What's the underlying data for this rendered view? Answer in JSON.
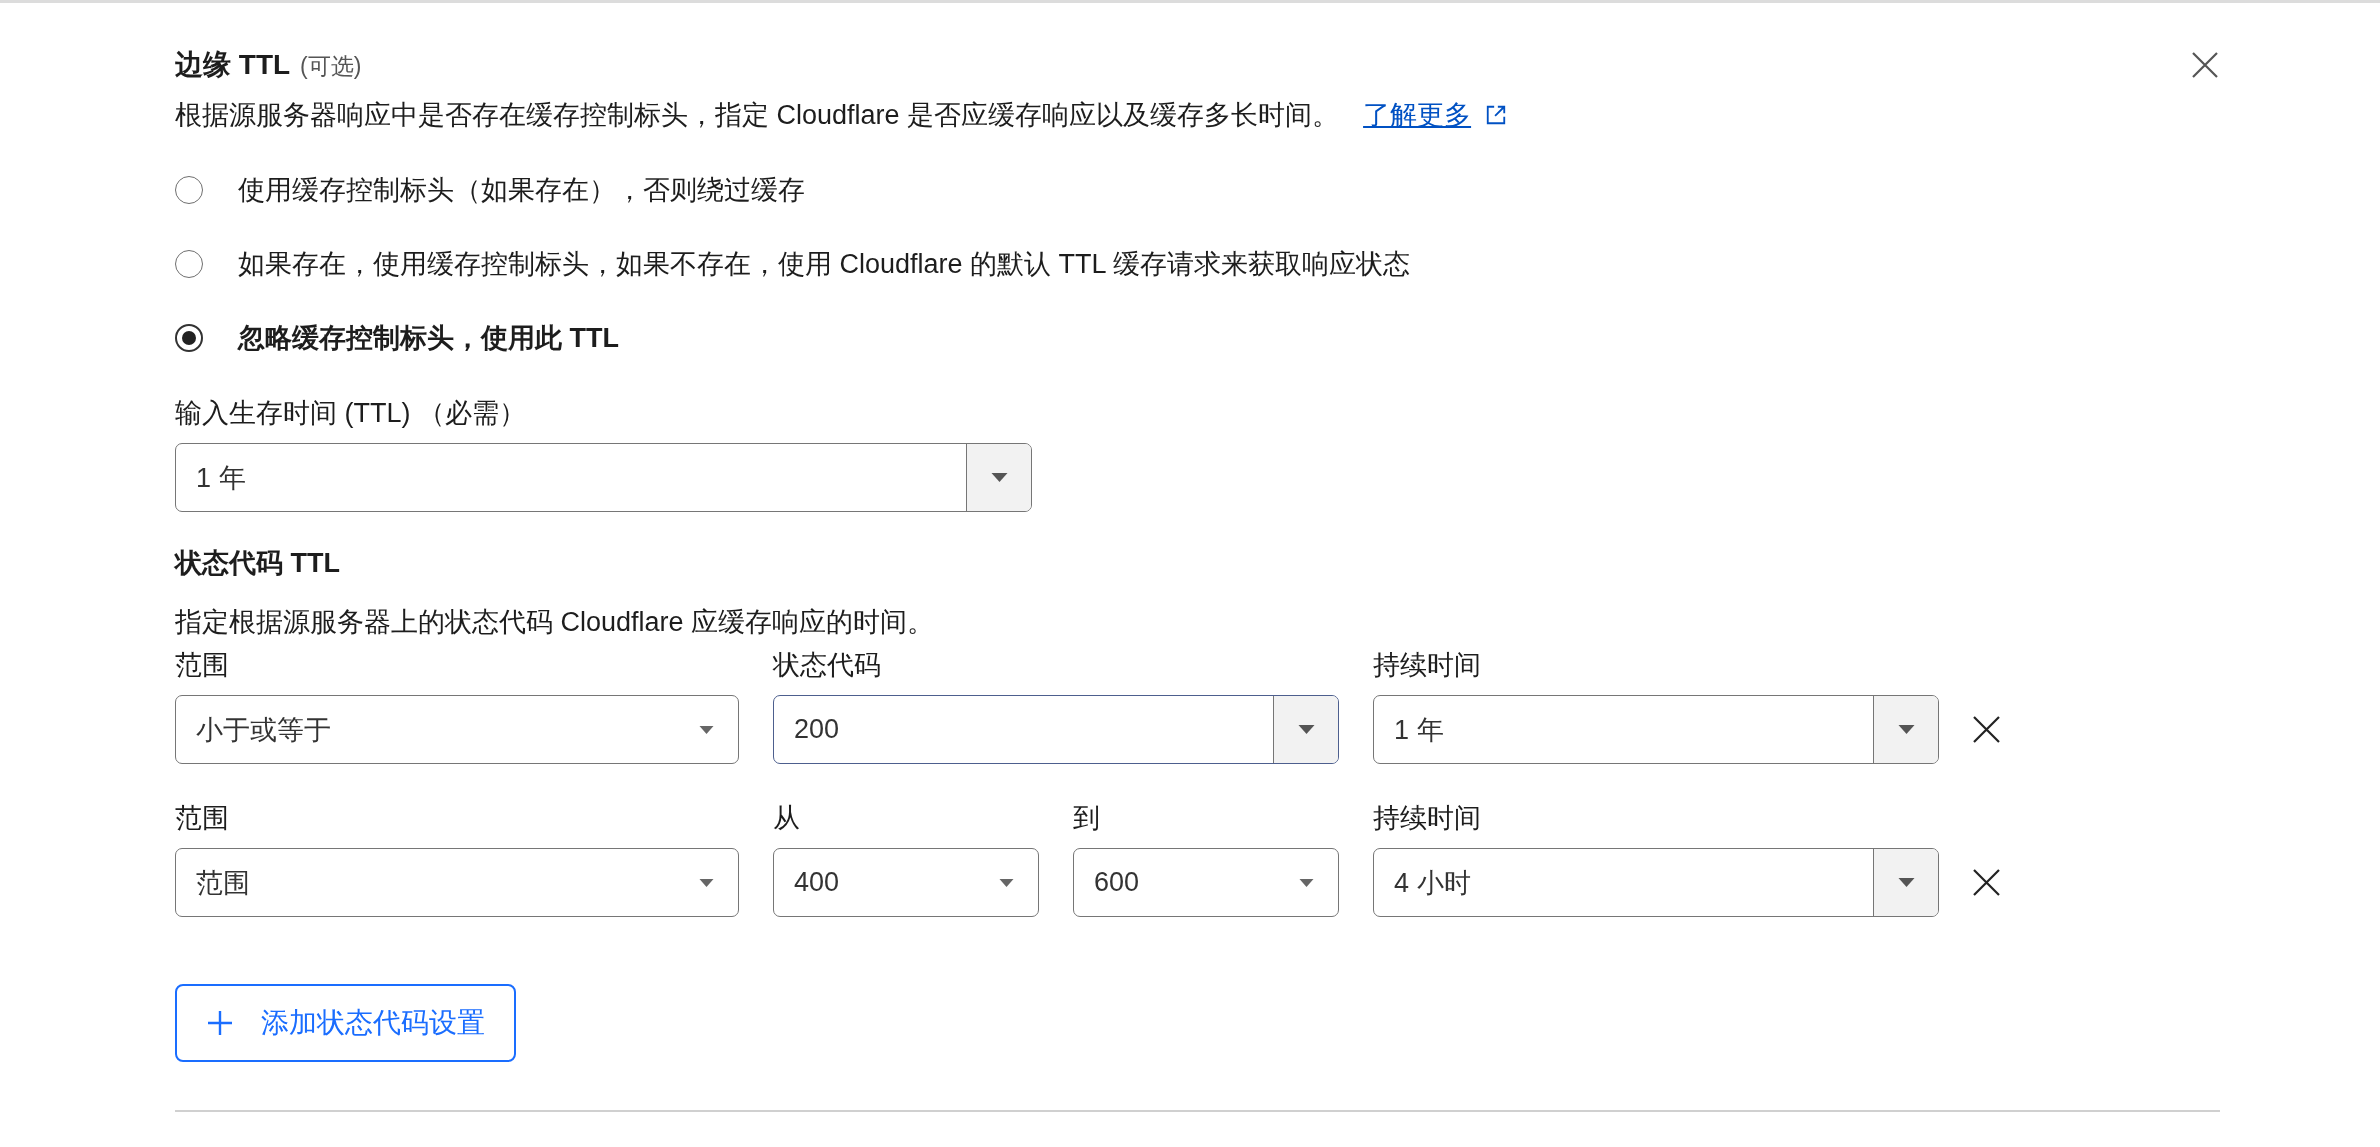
{
  "dialog": {
    "title": "边缘 TTL",
    "optional_note": "(可选)",
    "description": "根据源服务器响应中是否存在缓存控制标头，指定 Cloudflare 是否应缓存响应以及缓存多长时间。",
    "learn_more": "了解更多"
  },
  "options": [
    {
      "label": "使用缓存控制标头（如果存在），否则绕过缓存",
      "selected": false
    },
    {
      "label": "如果存在，使用缓存控制标头，如果不存在，使用 Cloudflare 的默认 TTL 缓存请求来获取响应状态",
      "selected": false
    },
    {
      "label": "忽略缓存控制标头，使用此 TTL",
      "selected": true
    }
  ],
  "ttl_field": {
    "label": "输入生存时间 (TTL) （必需）",
    "value": "1 年",
    "kind": "combobox"
  },
  "status_code_ttl": {
    "title": "状态代码 TTL",
    "description": "指定根据源服务器上的状态代码 Cloudflare 应缓存响应的时间。",
    "rules": [
      {
        "kind": "single_code",
        "fields": [
          {
            "label": "范围",
            "value": "小于或等于",
            "kind": "dropdown",
            "focused": false
          },
          {
            "label": "状态代码",
            "value": "200",
            "kind": "combobox",
            "focused": true
          },
          {
            "label": "持续时间",
            "value": "1 年",
            "kind": "combobox",
            "focused": false
          }
        ]
      },
      {
        "kind": "code_range",
        "fields": [
          {
            "label": "范围",
            "value": "范围",
            "kind": "dropdown",
            "focused": false
          },
          {
            "label": "从",
            "value": "400",
            "kind": "dropdown",
            "focused": false
          },
          {
            "label": "到",
            "value": "600",
            "kind": "dropdown",
            "focused": false
          },
          {
            "label": "持续时间",
            "value": "4 小时",
            "kind": "combobox",
            "focused": false
          }
        ]
      }
    ],
    "add_button": "添加状态代码设置"
  }
}
